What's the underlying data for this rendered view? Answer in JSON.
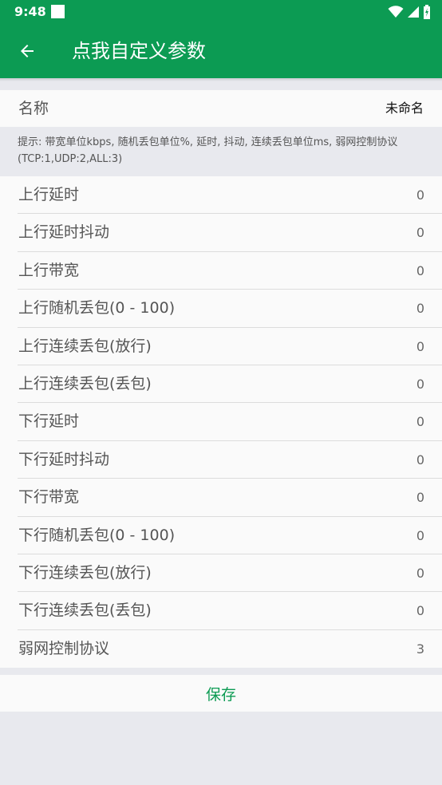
{
  "status_bar": {
    "time": "9:48"
  },
  "app_bar": {
    "title": "点我自定义参数"
  },
  "name_row": {
    "label": "名称",
    "value": "未命名"
  },
  "hint": "提示: 带宽单位kbps, 随机丢包单位%, 延时, 抖动, 连续丢包单位ms, 弱网控制协议(TCP:1,UDP:2,ALL:3)",
  "params": [
    {
      "label": "上行延时",
      "value": "0"
    },
    {
      "label": "上行延时抖动",
      "value": "0"
    },
    {
      "label": "上行带宽",
      "value": "0"
    },
    {
      "label": "上行随机丢包(0 - 100)",
      "value": "0"
    },
    {
      "label": "上行连续丢包(放行)",
      "value": "0"
    },
    {
      "label": "上行连续丢包(丢包)",
      "value": "0"
    },
    {
      "label": "下行延时",
      "value": "0"
    },
    {
      "label": "下行延时抖动",
      "value": "0"
    },
    {
      "label": "下行带宽",
      "value": "0"
    },
    {
      "label": "下行随机丢包(0 - 100)",
      "value": "0"
    },
    {
      "label": "下行连续丢包(放行)",
      "value": "0"
    },
    {
      "label": "下行连续丢包(丢包)",
      "value": "0"
    },
    {
      "label": "弱网控制协议",
      "value": "3"
    }
  ],
  "save_button": {
    "label": "保存"
  },
  "colors": {
    "primary": "#0c9b53",
    "background": "#e8e9ee",
    "row_background": "#fafafa"
  },
  "icons": {
    "back": "arrow-left-icon",
    "wifi": "wifi-icon",
    "signal": "cell-signal-icon",
    "battery": "battery-charging-icon",
    "notification": "notification-square-icon"
  }
}
